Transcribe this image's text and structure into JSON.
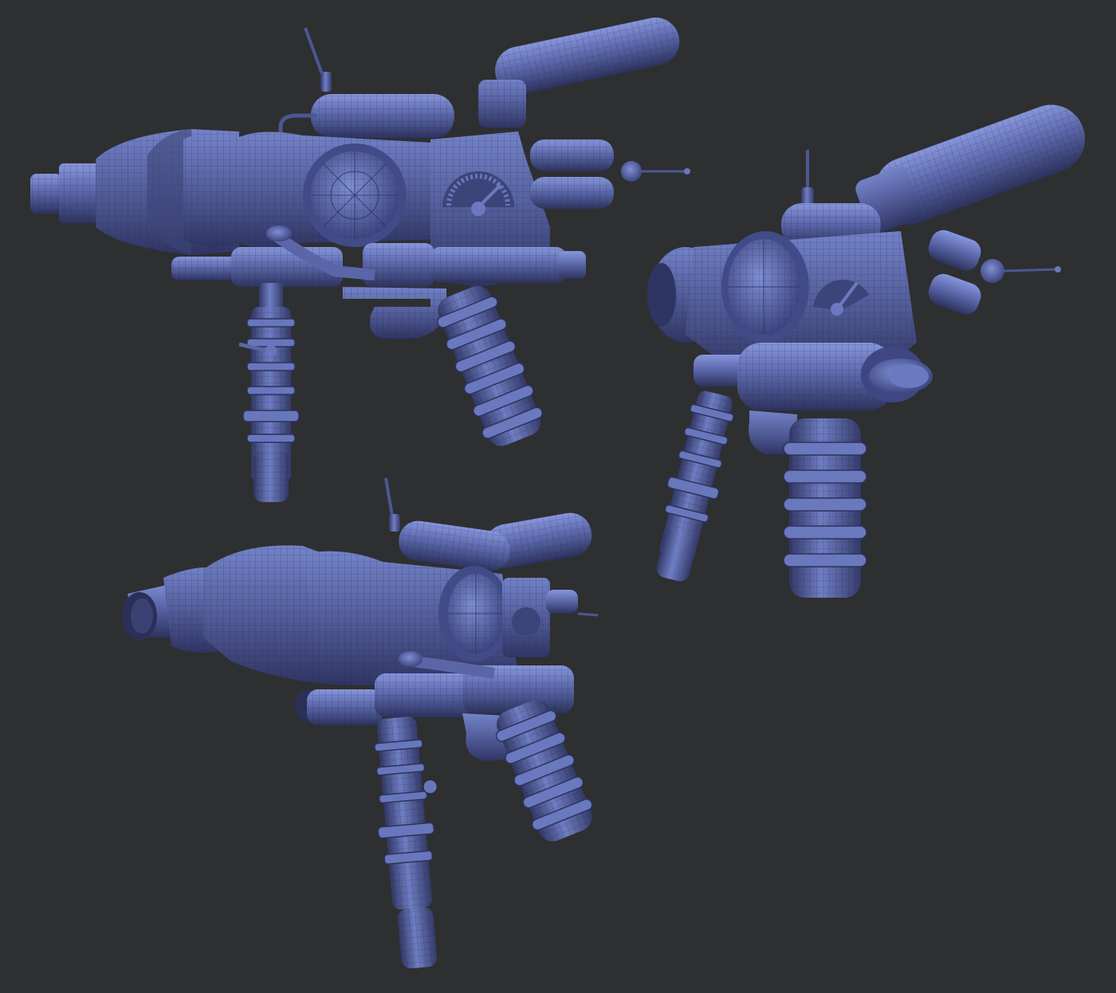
{
  "scene": {
    "background_color": "#2e2f31",
    "model_color": "#4f5b96",
    "model_highlight": "#7f8fd4",
    "model_shadow": "#2b3058",
    "wire_color": "#1d2240",
    "views": [
      {
        "name": "side-view"
      },
      {
        "name": "three-quarter-rear-view"
      },
      {
        "name": "three-quarter-front-view"
      }
    ]
  }
}
